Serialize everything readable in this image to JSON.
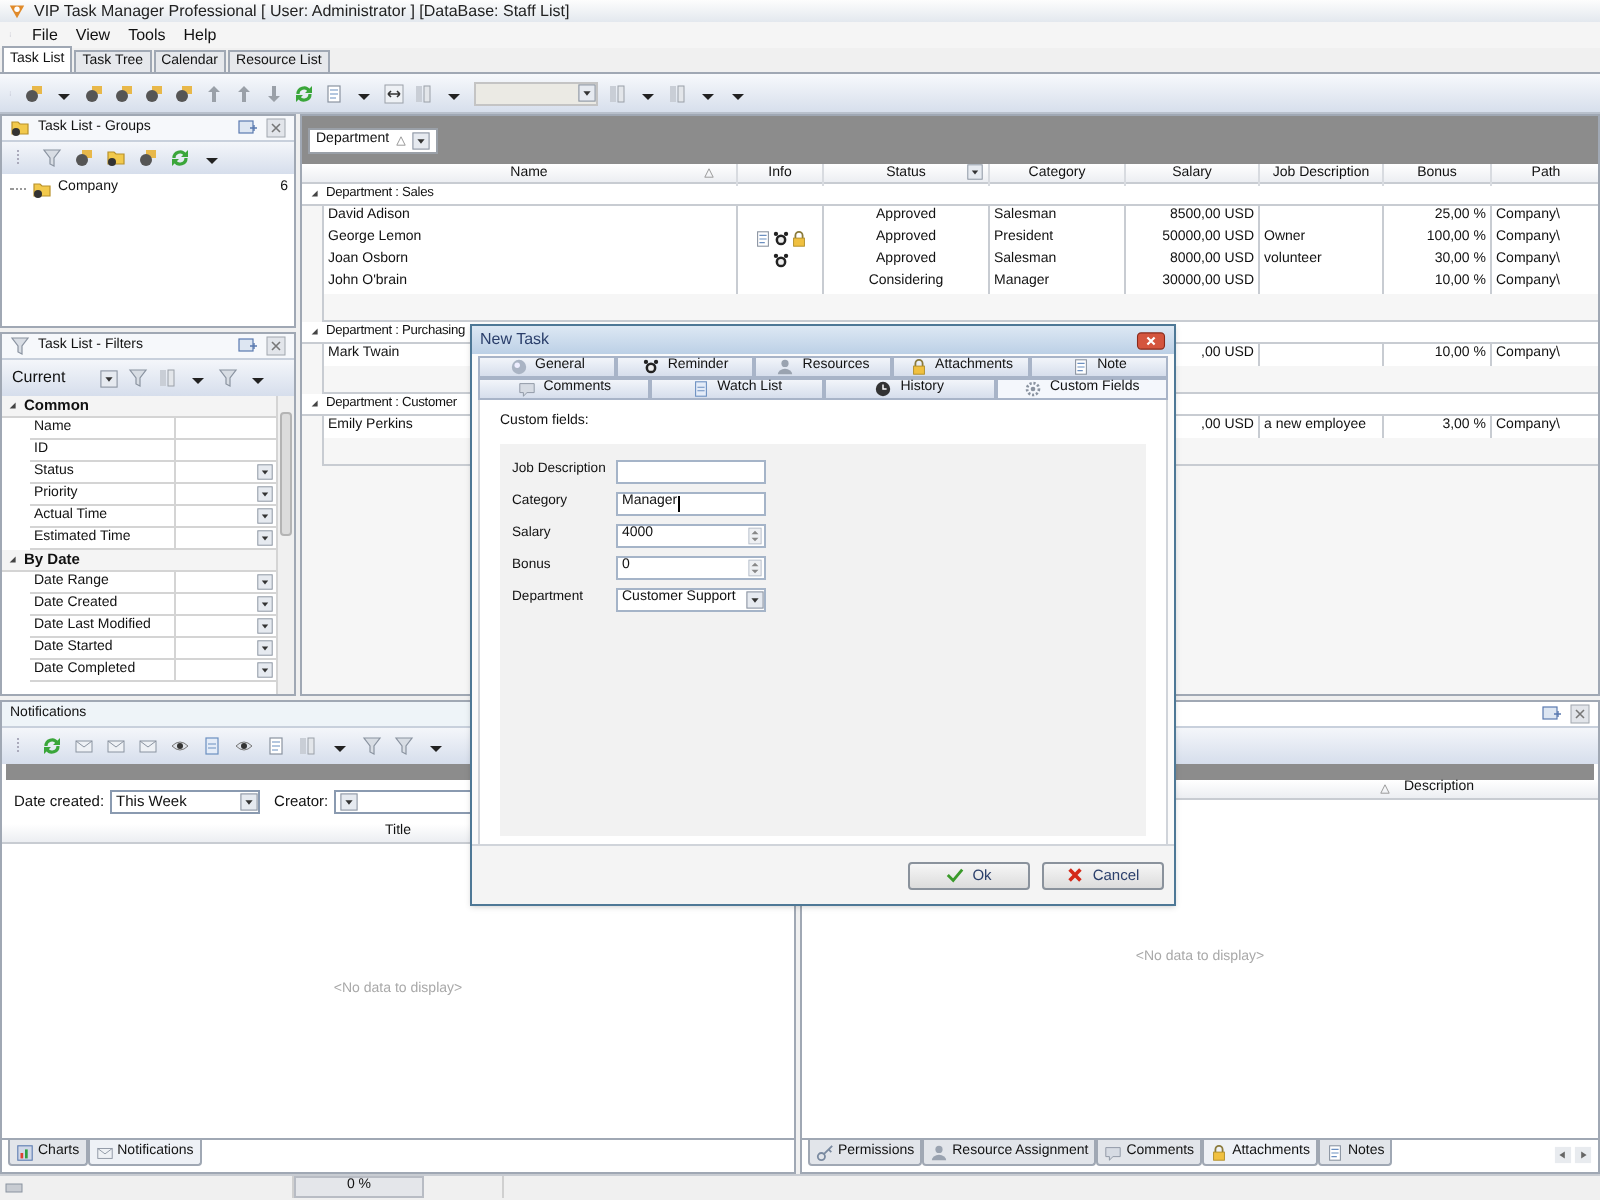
{
  "window": {
    "title": "VIP Task Manager Professional [ User: Administrator ] [DataBase: Staff List]"
  },
  "menu": [
    "File",
    "View",
    "Tools",
    "Help"
  ],
  "tabs": [
    {
      "label": "Task List",
      "selected": true
    },
    {
      "label": "Task Tree",
      "selected": false
    },
    {
      "label": "Calendar",
      "selected": false
    },
    {
      "label": "Resource List",
      "selected": false
    }
  ],
  "toolbar": {
    "combo": {
      "disabled": true
    }
  },
  "groups_panel": {
    "title": "Task List - Groups",
    "tree": [
      {
        "label": "Company",
        "count": "6"
      }
    ]
  },
  "filters_panel": {
    "title": "Task List - Filters",
    "view": "Current",
    "categories": [
      {
        "label": "Common",
        "expanded": true,
        "rows": [
          {
            "label": "Name",
            "kind": "text"
          },
          {
            "label": "ID",
            "kind": "text"
          },
          {
            "label": "Status",
            "kind": "dropdown"
          },
          {
            "label": "Priority",
            "kind": "dropdown"
          },
          {
            "label": "Actual Time",
            "kind": "dropdown"
          },
          {
            "label": "Estimated Time",
            "kind": "dropdown"
          }
        ]
      },
      {
        "label": "By Date",
        "expanded": true,
        "rows": [
          {
            "label": "Date Range",
            "kind": "dropdown"
          },
          {
            "label": "Date Created",
            "kind": "dropdown"
          },
          {
            "label": "Date Last Modified",
            "kind": "dropdown"
          },
          {
            "label": "Date Started",
            "kind": "dropdown"
          },
          {
            "label": "Date Completed",
            "kind": "dropdown"
          }
        ]
      }
    ]
  },
  "grid": {
    "group_by": "Department",
    "columns": [
      {
        "label": "Name",
        "sorted": true,
        "filter": false
      },
      {
        "label": "Info",
        "sorted": false,
        "filter": false
      },
      {
        "label": "Status",
        "sorted": false,
        "filter": true
      },
      {
        "label": "Category",
        "sorted": false,
        "filter": false
      },
      {
        "label": "Salary",
        "sorted": false,
        "filter": false
      },
      {
        "label": "Job Description",
        "sorted": false,
        "filter": false
      },
      {
        "label": "Bonus",
        "sorted": false,
        "filter": false
      },
      {
        "label": "Path",
        "sorted": false,
        "filter": false
      }
    ],
    "groups": [
      {
        "label": "Department : Sales",
        "expanded": true,
        "rows": [
          {
            "name": "David Adison",
            "status": "Approved",
            "category": "Salesman",
            "salary": "8500,00 USD",
            "bonus": "25,00 %",
            "path": "Company\\"
          },
          {
            "name": "George Lemon",
            "info": [
              {
                "kind": "note"
              },
              {
                "kind": "alarm"
              },
              {
                "kind": "lock"
              }
            ],
            "status": "Approved",
            "category": "President",
            "salary": "50000,00 USD",
            "job_description": "Owner",
            "bonus": "100,00 %",
            "path": "Company\\"
          },
          {
            "name": "Joan Osborn",
            "info": [
              {
                "kind": "alarm"
              }
            ],
            "status": "Approved",
            "category": "Salesman",
            "salary": "8000,00 USD",
            "job_description": "volunteer",
            "bonus": "30,00 %",
            "path": "Company\\"
          },
          {
            "name": "John O'brain",
            "status": "Considering",
            "category": "Manager",
            "salary": "30000,00 USD",
            "bonus": "10,00 %",
            "path": "Company\\"
          }
        ]
      },
      {
        "label": "Department : Purchasing",
        "expanded": true,
        "rows": [
          {
            "name": "Mark Twain",
            "salary": ",00 USD",
            "bonus": "10,00 %",
            "path": "Company\\"
          }
        ]
      },
      {
        "label": "Department : Customer",
        "expanded": true,
        "rows": [
          {
            "name": "Emily Perkins",
            "salary": ",00 USD",
            "job_description": "a new employee",
            "bonus": "3,00 %",
            "path": "Company\\"
          }
        ]
      }
    ]
  },
  "dialog": {
    "title": "New Task",
    "tab_rows": [
      {
        "tabs": [
          {
            "label": "General",
            "kind": "sphere",
            "selected": false
          },
          {
            "label": "Reminder",
            "kind": "alarm",
            "selected": false
          },
          {
            "label": "Resources",
            "kind": "person",
            "selected": false
          },
          {
            "label": "Attachments",
            "kind": "lock",
            "selected": false
          },
          {
            "label": "Note",
            "kind": "note",
            "selected": false
          }
        ]
      },
      {
        "tabs": [
          {
            "label": "Comments",
            "kind": "comment",
            "selected": false
          },
          {
            "label": "Watch List",
            "kind": "document",
            "selected": false
          },
          {
            "label": "History",
            "kind": "clock",
            "selected": false
          },
          {
            "label": "Custom Fields",
            "kind": "gear",
            "selected": true
          }
        ]
      }
    ],
    "section_label": "Custom fields:",
    "fields": [
      {
        "label": "Job Description",
        "kind": "text",
        "focused": false
      },
      {
        "label": "Category",
        "kind": "text",
        "value": "Manager",
        "focused": true
      },
      {
        "label": "Salary",
        "kind": "spin",
        "value": "4000",
        "focused": false
      },
      {
        "label": "Bonus",
        "kind": "spin",
        "value": "0",
        "focused": false
      },
      {
        "label": "Department",
        "kind": "combo",
        "value": "Customer Support",
        "focused": false
      }
    ],
    "buttons": [
      {
        "label": "Ok",
        "kind": "ok"
      },
      {
        "label": "Cancel",
        "kind": "cancel"
      }
    ]
  },
  "notifications": {
    "title": "Notifications",
    "filters": [
      {
        "label": "Date created:",
        "value": "This Week"
      },
      {
        "label": "Creator:"
      }
    ],
    "columns": [
      "Title"
    ],
    "empty_text": "<No data to display>",
    "tabs": [
      {
        "label": "Charts",
        "kind": "chart",
        "selected": false
      },
      {
        "label": "Notifications",
        "kind": "envelope",
        "selected": true
      }
    ]
  },
  "details": {
    "columns": [
      "Description"
    ],
    "empty_text": "<No data to display>",
    "tabs": [
      {
        "label": "Permissions",
        "kind": "key",
        "selected": false
      },
      {
        "label": "Resource Assignment",
        "kind": "person",
        "selected": false
      },
      {
        "label": "Comments",
        "kind": "comment",
        "selected": false
      },
      {
        "label": "Attachments",
        "kind": "lock",
        "selected": true
      },
      {
        "label": "Notes",
        "kind": "note",
        "selected": false
      }
    ]
  },
  "status_bar": {
    "progress": {
      "label": "0 %",
      "level": 0
    }
  }
}
